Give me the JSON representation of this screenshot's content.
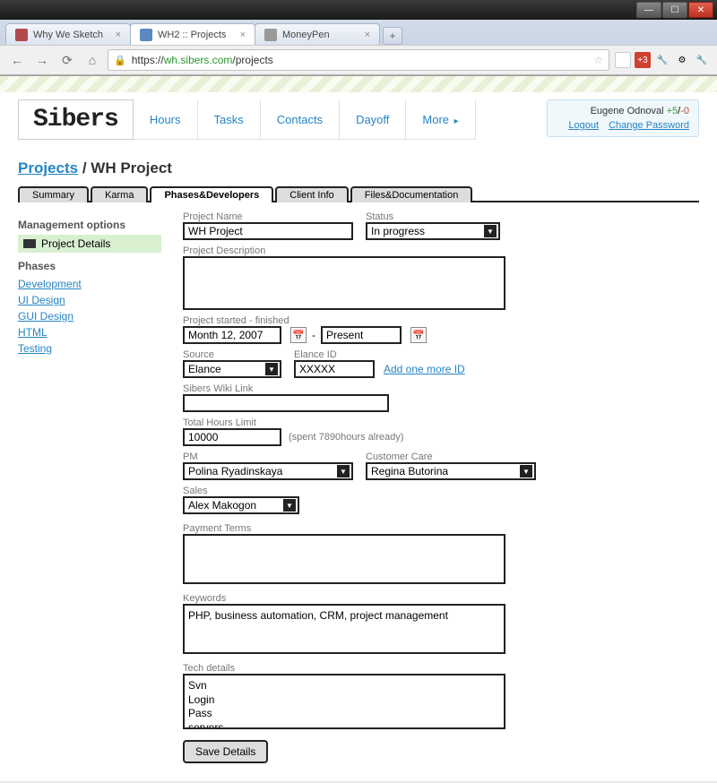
{
  "browser": {
    "tabs": [
      {
        "title": "Why We Sketch"
      },
      {
        "title": "WH2 :: Projects"
      },
      {
        "title": "MoneyPen"
      }
    ],
    "url_prefix": "https://",
    "url_host": "wh.sibers.com",
    "url_path": "/projects"
  },
  "header": {
    "logo": "Sibers",
    "nav": [
      "Hours",
      "Tasks",
      "Contacts",
      "Dayoff",
      "More"
    ],
    "user": {
      "name": "Eugene Odnoval",
      "plus": "+5",
      "sep": "/",
      "minus": "-0",
      "logout": "Logout",
      "change_pw": "Change Password"
    }
  },
  "breadcrumb": {
    "root": "Projects",
    "current": "WH Project"
  },
  "ptabs": [
    "Summary",
    "Karma",
    "Phases&Developers",
    "Client Info",
    "Files&Documentation"
  ],
  "sidebar": {
    "mgmt_head": "Management options",
    "mgmt_item": "Project Details",
    "phases_head": "Phases",
    "phases": [
      "Development",
      "UI Design",
      "GUI Design",
      "HTML",
      "Testing"
    ]
  },
  "form": {
    "project_name_label": "Project Name",
    "project_name": "WH Project",
    "status_label": "Status",
    "status": "In progress",
    "desc_label": "Project Description",
    "desc": "",
    "dates_label": "Project started - finished",
    "date_start": "Month 12, 2007",
    "date_sep": "-",
    "date_end": "Present",
    "source_label": "Source",
    "source": "Elance",
    "elance_label": "Elance ID",
    "elance_id": "XXXXX",
    "add_id": "Add one more ID",
    "wiki_label": "Sibers Wiki Link",
    "wiki": "",
    "hours_label": "Total Hours Limit",
    "hours": "10000",
    "hours_note": "(spent 7890hours already)",
    "pm_label": "PM",
    "pm": "Polina Ryadinskaya",
    "cc_label": "Customer Care",
    "cc": "Regina Butorina",
    "sales_label": "Sales",
    "sales": "Alex Makogon",
    "payment_label": "Payment Terms",
    "payment": "",
    "keywords_label": "Keywords",
    "keywords": "PHP, business automation, CRM, project management",
    "tech_label": "Tech details",
    "tech": "Svn\nLogin\nPass\nservers",
    "save": "Save Details"
  }
}
